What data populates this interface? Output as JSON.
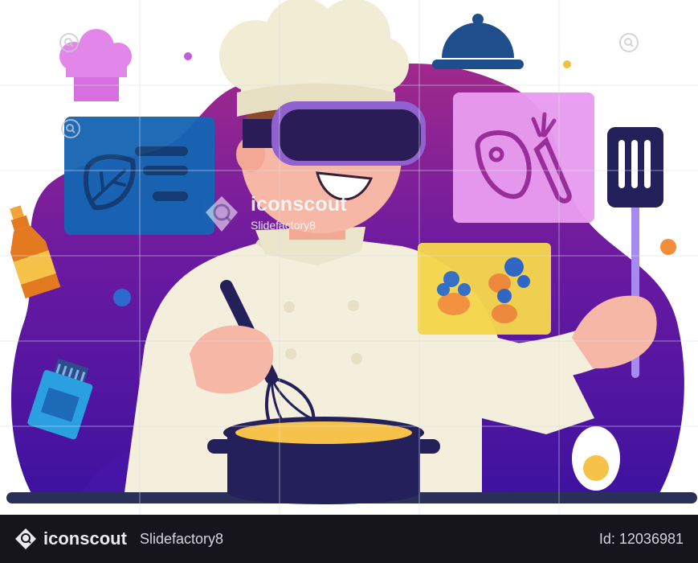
{
  "watermark": {
    "brand": "iconscout",
    "author": "Slidefactory8"
  },
  "footer": {
    "brand": "iconscout",
    "author": "Slidefactory8",
    "id_text": "Id: 12036981"
  },
  "colors": {
    "background_purple": "#5a159c",
    "chef_white": "#f3efdc",
    "skin": "#f6b7a6",
    "vr_headset": "#2a1d57",
    "vr_frame": "#8f62cf",
    "pot": "#23205a",
    "panel_blue": "#1665b4",
    "panel_pink": "#e99cf0",
    "panel_yellow": "#f6d64c",
    "footer_bg": "#15151b"
  },
  "icons": [
    "chef-hat-icon",
    "food-cloche-icon",
    "leaf-recipe-panel-icon",
    "meat-carrot-panel-icon",
    "vegetables-panel-icon",
    "spatula-icon",
    "whisk-icon",
    "cooking-pot-icon",
    "sauce-bottle-icon",
    "spice-jar-icon",
    "boiled-egg-icon",
    "magnifier-icon"
  ]
}
